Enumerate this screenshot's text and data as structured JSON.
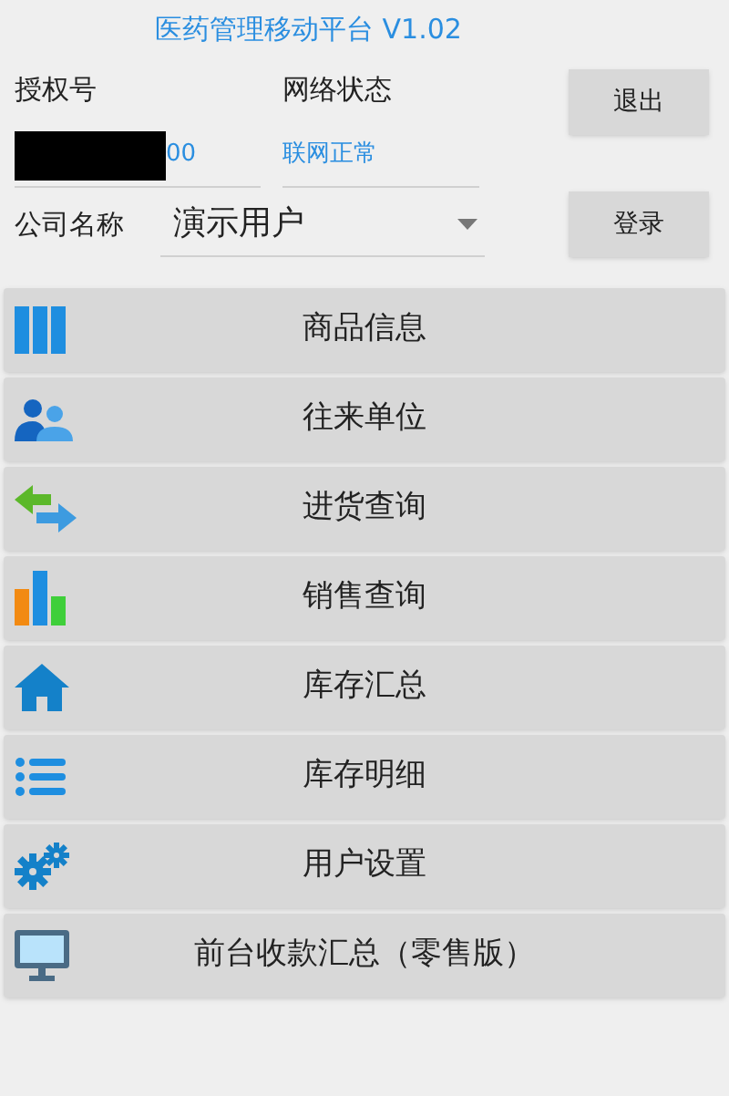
{
  "title": "医药管理移动平台 V1.02",
  "license": {
    "label": "授权号",
    "value": "00"
  },
  "network": {
    "label": "网络状态",
    "value": "联网正常"
  },
  "company": {
    "label": "公司名称",
    "value": "演示用户"
  },
  "buttons": [
    "退出",
    "登录"
  ],
  "menu": [
    {
      "label": "商品信息"
    },
    {
      "label": "往来单位"
    },
    {
      "label": "进货查询"
    },
    {
      "label": "销售查询"
    },
    {
      "label": "库存汇总"
    },
    {
      "label": "库存明细"
    },
    {
      "label": "用户设置"
    },
    {
      "label": "前台收款汇总（零售版）"
    }
  ]
}
